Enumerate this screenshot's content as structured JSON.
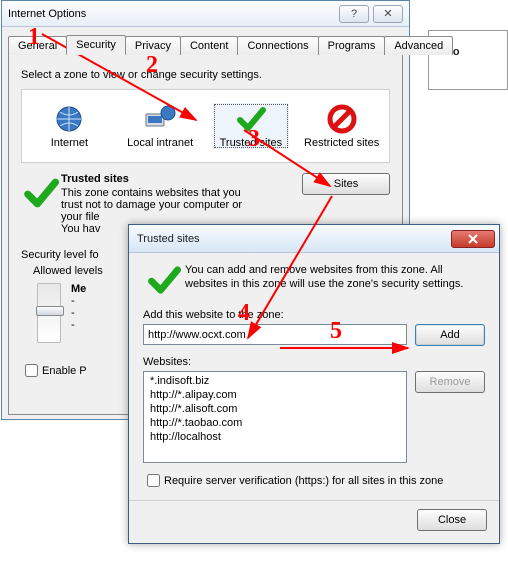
{
  "bg": {
    "text": "emo"
  },
  "io": {
    "title": "Internet Options",
    "help_glyph": "?",
    "close_glyph": "✕",
    "tabs": [
      "General",
      "Security",
      "Privacy",
      "Content",
      "Connections",
      "Programs",
      "Advanced"
    ],
    "active_tab": 1,
    "zone_prompt": "Select a zone to view or change security settings.",
    "zones": [
      {
        "label": "Internet"
      },
      {
        "label": "Local intranet"
      },
      {
        "label": "Trusted sites"
      },
      {
        "label": "Restricted sites"
      }
    ],
    "trusted": {
      "heading": "Trusted sites",
      "desc_l1": "This zone contains websites that you",
      "desc_l2": "trust not to damage your computer or",
      "desc_l3": "your file",
      "desc_l4": "You hav",
      "sites_btn": "Sites"
    },
    "sec": {
      "heading": "Security level fo",
      "allowed": "Allowed levels",
      "level_name": "Me",
      "dash1": "-",
      "dash2": "-",
      "dash3": "-",
      "enable": "Enable P"
    }
  },
  "ts": {
    "title": "Trusted sites",
    "intro": "You can add and remove websites from this zone. All websites in this zone will use the zone's security settings.",
    "add_label": "Add this website to the zone:",
    "add_value": "http://www.ocxt.com",
    "add_btn": "Add",
    "list_label": "Websites:",
    "items": [
      "*.indisoft.biz",
      "http://*.alipay.com",
      "http://*.alisoft.com",
      "http://*.taobao.com",
      "http://localhost"
    ],
    "remove_btn": "Remove",
    "require": "Require server verification (https:) for all sites in this zone",
    "close_btn": "Close"
  },
  "annotations": {
    "n1": "1",
    "n2": "2",
    "n3": "3",
    "n4": "4",
    "n5": "5"
  }
}
